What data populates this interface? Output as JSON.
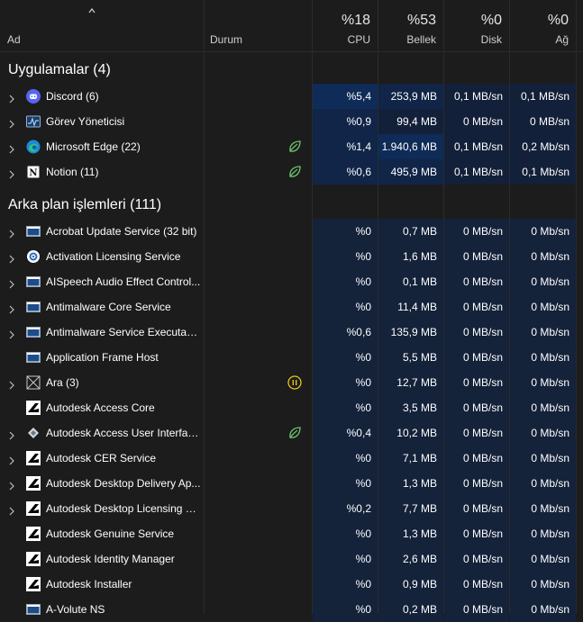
{
  "header": {
    "name_label": "Ad",
    "status_label": "Durum",
    "cpu_pct": "%18",
    "cpu_label": "CPU",
    "mem_pct": "%53",
    "mem_label": "Bellek",
    "disk_pct": "%0",
    "disk_label": "Disk",
    "net_pct": "%0",
    "net_label": "Ağ"
  },
  "sections": {
    "apps": "Uygulamalar (4)",
    "background": "Arka plan işlemleri (111)"
  },
  "apps": [
    {
      "name": "Discord (6)",
      "icon": "discord-icon",
      "status": "",
      "cpu": "%5,4",
      "mem": "253,9 MB",
      "disk": "0,1 MB/sn",
      "net": "0,1 MB/sn"
    },
    {
      "name": "Görev Yöneticisi",
      "icon": "task-manager-icon",
      "status": "",
      "cpu": "%0,9",
      "mem": "99,4 MB",
      "disk": "0 MB/sn",
      "net": "0 MB/sn"
    },
    {
      "name": "Microsoft Edge (22)",
      "icon": "edge-icon",
      "status": "efficiency-leaf-icon",
      "cpu": "%1,4",
      "mem": "1.940,6 MB",
      "disk": "0,1 MB/sn",
      "net": "0,2 Mb/sn"
    },
    {
      "name": "Notion (11)",
      "icon": "notion-icon",
      "status": "efficiency-leaf-icon",
      "cpu": "%0,6",
      "mem": "495,9 MB",
      "disk": "0,1 MB/sn",
      "net": "0,1 Mb/sn"
    }
  ],
  "background": [
    {
      "name": "Acrobat Update Service (32 bit)",
      "icon": "window-icon",
      "status": "",
      "cpu": "%0",
      "mem": "0,7 MB",
      "disk": "0 MB/sn",
      "net": "0 Mb/sn"
    },
    {
      "name": "Activation Licensing Service",
      "icon": "gear-icon",
      "status": "",
      "cpu": "%0",
      "mem": "1,6 MB",
      "disk": "0 MB/sn",
      "net": "0 Mb/sn"
    },
    {
      "name": "AISpeech Audio Effect Control...",
      "icon": "window-icon",
      "status": "",
      "cpu": "%0",
      "mem": "0,1 MB",
      "disk": "0 MB/sn",
      "net": "0 Mb/sn"
    },
    {
      "name": "Antimalware Core Service",
      "icon": "window-icon",
      "status": "",
      "cpu": "%0",
      "mem": "11,4 MB",
      "disk": "0 MB/sn",
      "net": "0 Mb/sn"
    },
    {
      "name": "Antimalware Service Executable",
      "icon": "window-icon",
      "status": "",
      "cpu": "%0,6",
      "mem": "135,9 MB",
      "disk": "0 MB/sn",
      "net": "0 Mb/sn"
    },
    {
      "name": "Application Frame Host",
      "icon": "window-icon",
      "status": "",
      "cpu": "%0",
      "mem": "5,5 MB",
      "disk": "0 MB/sn",
      "net": "0 Mb/sn"
    },
    {
      "name": "Ara (3)",
      "icon": "search-app-icon",
      "status": "suspended-pause-icon",
      "cpu": "%0",
      "mem": "12,7 MB",
      "disk": "0 MB/sn",
      "net": "0 Mb/sn"
    },
    {
      "name": "Autodesk Access Core",
      "icon": "autodesk-icon",
      "status": "",
      "cpu": "%0",
      "mem": "3,5 MB",
      "disk": "0 MB/sn",
      "net": "0 Mb/sn"
    },
    {
      "name": "Autodesk Access User Interfac...",
      "icon": "autodesk-access-icon",
      "status": "efficiency-leaf-icon",
      "cpu": "%0,4",
      "mem": "10,2 MB",
      "disk": "0 MB/sn",
      "net": "0 Mb/sn"
    },
    {
      "name": "Autodesk CER Service",
      "icon": "autodesk-icon",
      "status": "",
      "cpu": "%0",
      "mem": "7,1 MB",
      "disk": "0 MB/sn",
      "net": "0 Mb/sn"
    },
    {
      "name": "Autodesk Desktop Delivery Ap...",
      "icon": "autodesk-icon",
      "status": "",
      "cpu": "%0",
      "mem": "1,3 MB",
      "disk": "0 MB/sn",
      "net": "0 Mb/sn"
    },
    {
      "name": "Autodesk Desktop Licensing S...",
      "icon": "autodesk-icon",
      "status": "",
      "cpu": "%0,2",
      "mem": "7,7 MB",
      "disk": "0 MB/sn",
      "net": "0 Mb/sn"
    },
    {
      "name": "Autodesk Genuine Service",
      "icon": "autodesk-icon",
      "status": "",
      "cpu": "%0",
      "mem": "1,3 MB",
      "disk": "0 MB/sn",
      "net": "0 Mb/sn"
    },
    {
      "name": "Autodesk Identity Manager",
      "icon": "autodesk-icon",
      "status": "",
      "cpu": "%0",
      "mem": "2,6 MB",
      "disk": "0 MB/sn",
      "net": "0 Mb/sn"
    },
    {
      "name": "Autodesk Installer",
      "icon": "autodesk-icon",
      "status": "",
      "cpu": "%0",
      "mem": "0,9 MB",
      "disk": "0 MB/sn",
      "net": "0 Mb/sn"
    },
    {
      "name": "A-Volute NS",
      "icon": "window-icon",
      "status": "",
      "cpu": "%0",
      "mem": "0,2 MB",
      "disk": "0 MB/sn",
      "net": "0 Mb/sn"
    }
  ],
  "colors": {
    "background": "#1c1c1c",
    "heat_high": "#0f2b57",
    "heat_mid": "#102548",
    "heat_low": "#14223a",
    "leaf_green": "#6cc66c",
    "pause_yellow": "#e6c619"
  }
}
